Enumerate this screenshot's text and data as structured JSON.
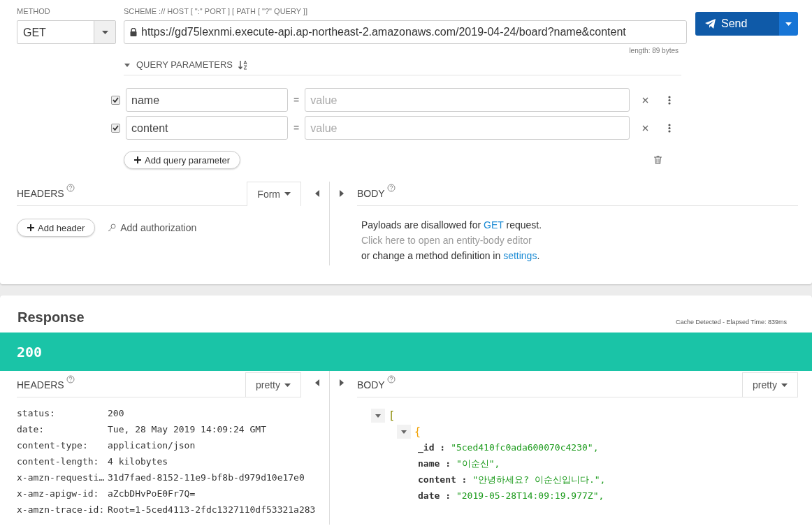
{
  "request": {
    "method_label": "METHOD",
    "method": "GET",
    "url_label": "SCHEME :// HOST [ \":\" PORT ] [ PATH [ \"?\" QUERY ]]",
    "url": "https://gd75lexnmi.execute-api.ap-northeast-2.amazonaws.com/2019-04-24/board?name&content",
    "length": "length: 89 bytes",
    "send": "Send",
    "query": {
      "title": "QUERY PARAMETERS",
      "expanded": true,
      "params": [
        {
          "name": "name",
          "separator": "=",
          "placeholder": "value",
          "checked": true
        },
        {
          "name": "content",
          "separator": "=",
          "placeholder": "value",
          "checked": true
        }
      ],
      "add_button": "Add query parameter"
    },
    "headers": {
      "title": "HEADERS",
      "mode": "Form",
      "add_header": "Add header",
      "add_authorization": "Add authorization"
    },
    "body": {
      "title": "BODY",
      "line1_before": "Payloads are disallowed for ",
      "line1_link": "GET",
      "line1_after": " request.",
      "line2": "Click here to open an entity-body editor",
      "line3_before": "or change a method definition in ",
      "line3_link": "settings",
      "line3_after": "."
    }
  },
  "response": {
    "title": "Response",
    "cache_info": "Cache Detected - Elapsed Time: 839ms",
    "status": "200",
    "headers": {
      "title": "HEADERS",
      "format": "pretty",
      "rows": [
        {
          "key": "status:",
          "value": "200"
        },
        {
          "key": "date:",
          "value": "Tue, 28 May 2019 14:09:24 GMT"
        },
        {
          "key": "content-type:",
          "value": "application/json"
        },
        {
          "key": "content-length:",
          "value": "4 kilobytes"
        },
        {
          "key": "x-amzn-requesti…",
          "value": "31d7faed-8152-11e9-bf8b-d979d10e17e0"
        },
        {
          "key": "x-amz-apigw-id:",
          "value": "aZcbDHvPoE0Fr7Q="
        },
        {
          "key": "x-amzn-trace-id:",
          "value": "Root=1-5ced4113-2fdc1327110df53321a283"
        }
      ]
    },
    "body": {
      "title": "BODY",
      "format": "pretty",
      "tree": {
        "bracket": "[",
        "expanded": true,
        "children": [
          {
            "bracket": "{",
            "expanded": true,
            "fields": [
              {
                "key": "_id :",
                "value": "\"5ced410fc0ada600070c4230\","
              },
              {
                "key": "name :",
                "value": "\"이순신\","
              },
              {
                "key": "content :",
                "value": "\"안녕하세요? 이순신입니다.\","
              },
              {
                "key": "date :",
                "value": "\"2019-05-28T14:09:19.977Z\","
              }
            ]
          }
        ]
      }
    }
  }
}
